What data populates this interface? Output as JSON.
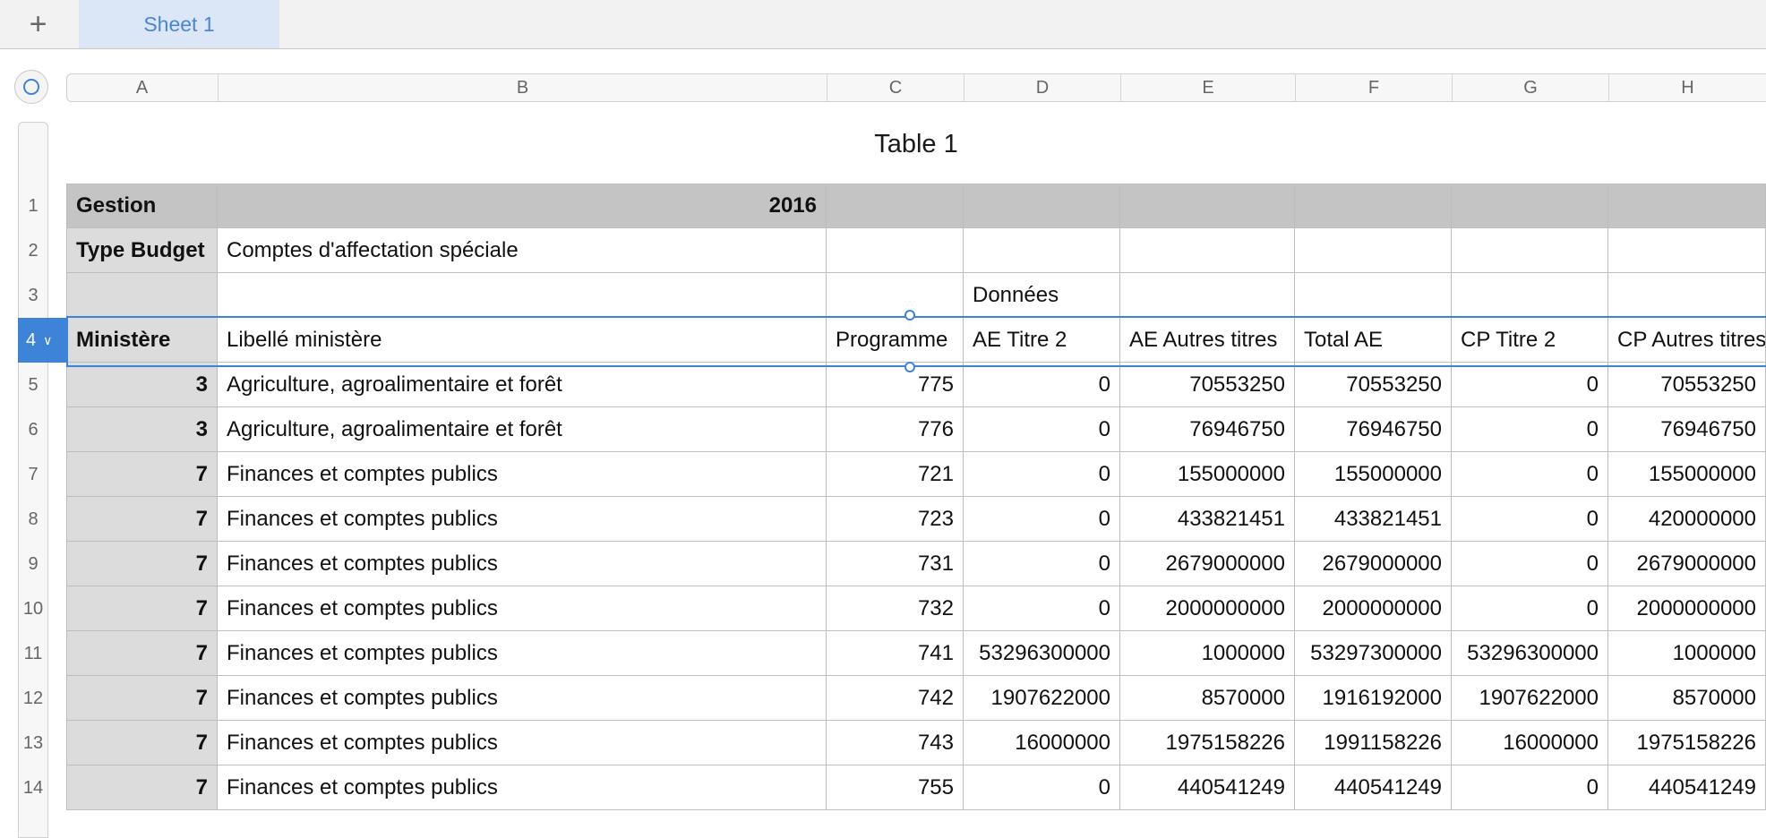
{
  "tabbar": {
    "add_label": "+",
    "sheet_tab": "Sheet 1"
  },
  "columns": [
    "A",
    "B",
    "C",
    "D",
    "E",
    "F",
    "G",
    "H"
  ],
  "row_numbers": [
    "1",
    "2",
    "3",
    "4",
    "5",
    "6",
    "7",
    "8",
    "9",
    "10",
    "11",
    "12",
    "13",
    "14"
  ],
  "selected_row": "4",
  "table_title": "Table 1",
  "rows": [
    [
      "Gestion",
      "2016",
      "",
      "",
      "",
      "",
      "",
      ""
    ],
    [
      "Type Budget",
      "Comptes d'affectation spéciale",
      "",
      "",
      "",
      "",
      "",
      ""
    ],
    [
      "",
      "",
      "",
      "Données",
      "",
      "",
      "",
      ""
    ],
    [
      "Ministère",
      "Libellé ministère",
      "Programme",
      "AE Titre 2",
      "AE Autres titres",
      "Total AE",
      "CP Titre 2",
      "CP Autres titres"
    ],
    [
      "3",
      "Agriculture, agroalimentaire et forêt",
      "775",
      "0",
      "70553250",
      "70553250",
      "0",
      "70553250"
    ],
    [
      "3",
      "Agriculture, agroalimentaire et forêt",
      "776",
      "0",
      "76946750",
      "76946750",
      "0",
      "76946750"
    ],
    [
      "7",
      "Finances et comptes publics",
      "721",
      "0",
      "155000000",
      "155000000",
      "0",
      "155000000"
    ],
    [
      "7",
      "Finances et comptes publics",
      "723",
      "0",
      "433821451",
      "433821451",
      "0",
      "420000000"
    ],
    [
      "7",
      "Finances et comptes publics",
      "731",
      "0",
      "2679000000",
      "2679000000",
      "0",
      "2679000000"
    ],
    [
      "7",
      "Finances et comptes publics",
      "732",
      "0",
      "2000000000",
      "2000000000",
      "0",
      "2000000000"
    ],
    [
      "7",
      "Finances et comptes publics",
      "741",
      "53296300000",
      "1000000",
      "53297300000",
      "53296300000",
      "1000000"
    ],
    [
      "7",
      "Finances et comptes publics",
      "742",
      "1907622000",
      "8570000",
      "1916192000",
      "1907622000",
      "8570000"
    ],
    [
      "7",
      "Finances et comptes publics",
      "743",
      "16000000",
      "1975158226",
      "1991158226",
      "16000000",
      "1975158226"
    ],
    [
      "7",
      "Finances et comptes publics",
      "755",
      "0",
      "440541249",
      "440541249",
      "0",
      "440541249"
    ]
  ],
  "colors": {
    "accent": "#3d84d8",
    "header_gray": "#c4c4c4",
    "col_a_gray": "#dcdcdc"
  }
}
